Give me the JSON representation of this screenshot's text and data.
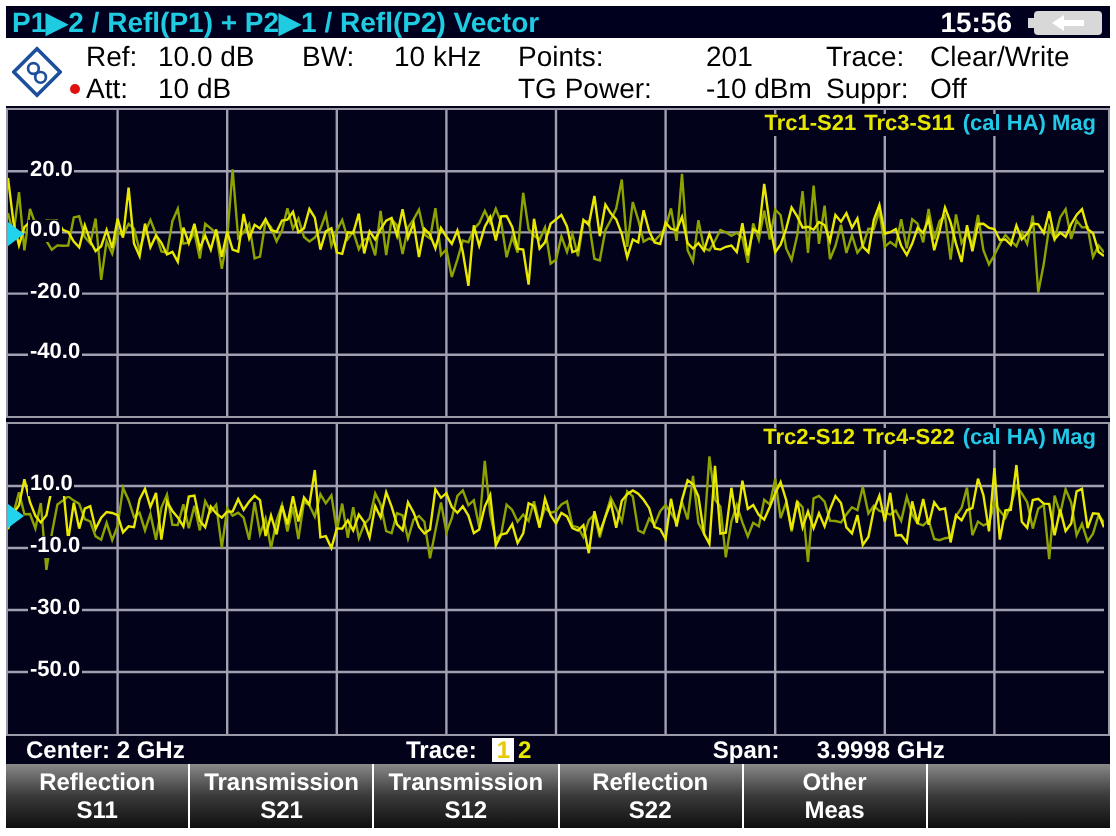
{
  "title_bar": {
    "title": "P1▶2 / Refl(P1) + P2▶1 / Refl(P2) Vector",
    "time": "15:56"
  },
  "header": {
    "columns": [
      {
        "items": [
          {
            "label": "Ref:",
            "value": "10.0 dB",
            "alert": false
          },
          {
            "label": "Att:",
            "value": "10 dB",
            "alert": true
          }
        ]
      },
      {
        "items": [
          {
            "label": "BW:",
            "value": "10 kHz"
          }
        ]
      },
      {
        "items": [
          {
            "label": "Points:",
            "value": "201"
          },
          {
            "label": "TG Power:",
            "value": "-10 dBm"
          }
        ]
      },
      {
        "items": [
          {
            "label": "Trace:",
            "value": "Clear/Write"
          },
          {
            "label": "Suppr:",
            "value": "Off"
          }
        ]
      }
    ]
  },
  "plots": [
    {
      "legend": [
        {
          "text": "Trc1-S21",
          "color": "#e6e600"
        },
        {
          "text": "Trc3-S11",
          "color": "#e6e600"
        },
        {
          "text": "(cal HA) Mag",
          "color": "#22c8e6"
        }
      ],
      "y_labels": [
        "20.0",
        "0.0",
        "-20.0",
        "-40.0"
      ]
    },
    {
      "legend": [
        {
          "text": "Trc2-S12",
          "color": "#e6e600"
        },
        {
          "text": "Trc4-S22",
          "color": "#e6e600"
        },
        {
          "text": "(cal HA) Mag",
          "color": "#22c8e6"
        }
      ],
      "y_labels": [
        "10.0",
        "-10.0",
        "-30.0",
        "-50.0"
      ]
    }
  ],
  "status_bar": {
    "center": "Center: 2 GHz",
    "trace_label": "Trace:",
    "traces": [
      {
        "label": "1",
        "selected": true
      },
      {
        "label": "2",
        "selected": false
      }
    ],
    "span_label": "Span:",
    "span": "3.9998 GHz"
  },
  "softkeys": [
    [
      "Reflection",
      "S11"
    ],
    [
      "Transmission",
      "S21"
    ],
    [
      "Transmission",
      "S12"
    ],
    [
      "Reflection",
      "S22"
    ],
    [
      "Other",
      "Meas"
    ]
  ]
}
